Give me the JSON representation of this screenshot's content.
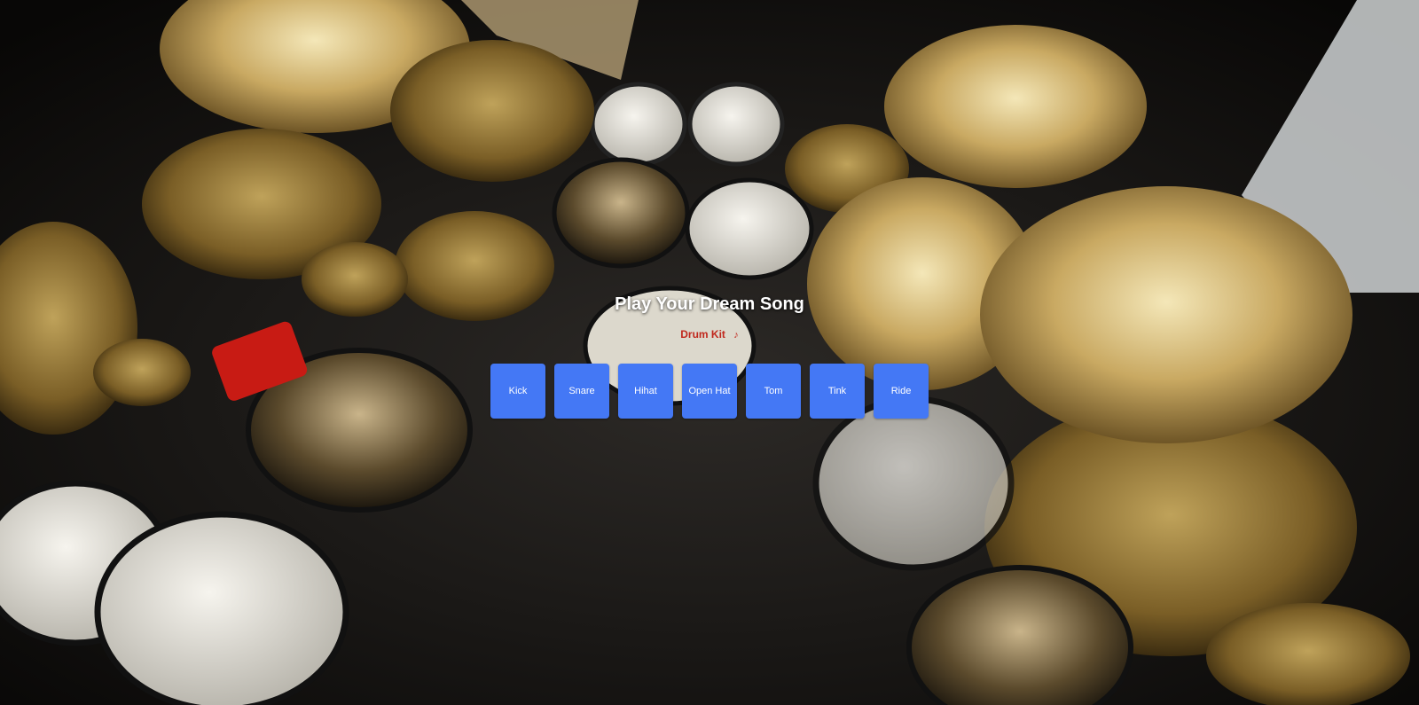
{
  "page": {
    "headline": "Play Your Dream Song",
    "kit_label": "Drum Kit",
    "kit_icon": "drum-icon"
  },
  "pads": [
    {
      "label": "Kick"
    },
    {
      "label": "Snare"
    },
    {
      "label": "Hihat"
    },
    {
      "label": "Open Hat"
    },
    {
      "label": "Tom"
    },
    {
      "label": "Tink"
    },
    {
      "label": "Ride"
    }
  ],
  "colors": {
    "pad": "#4478f5",
    "pad_text": "#ffffff",
    "kit_label": "#c0271c",
    "headline": "#ffffff"
  }
}
